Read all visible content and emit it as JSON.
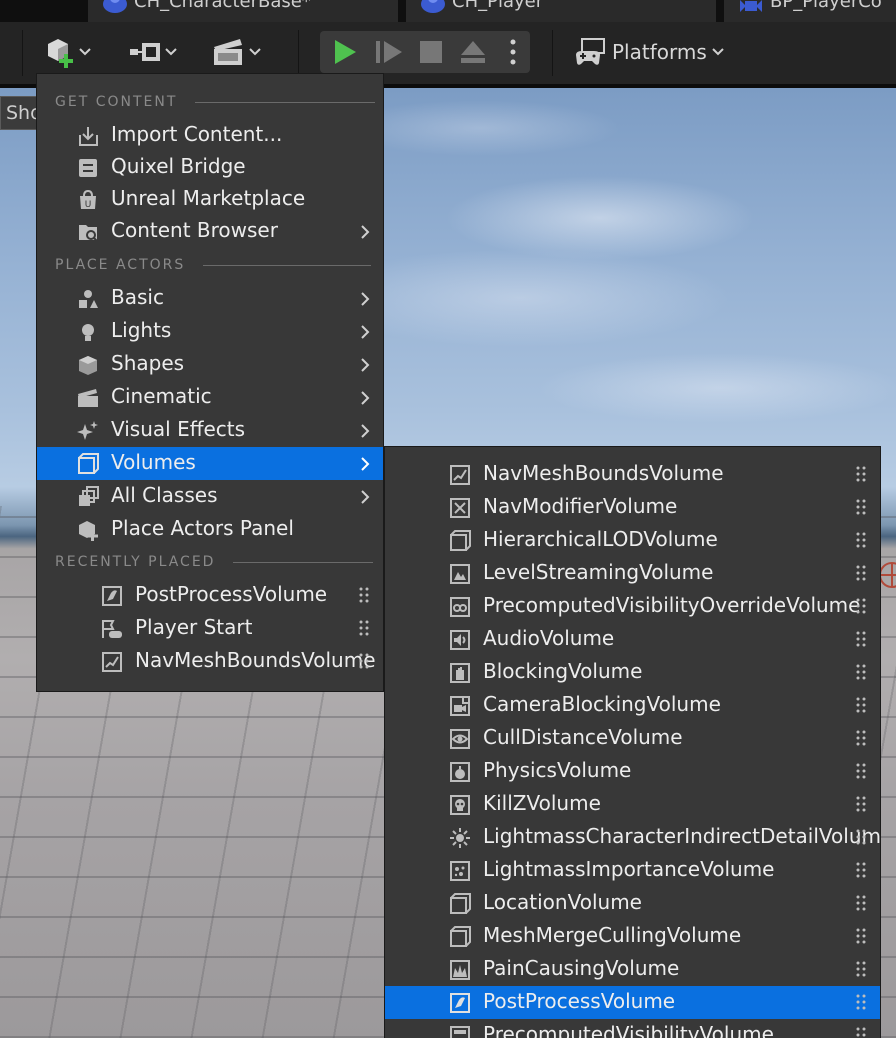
{
  "document_tabs": [
    "CH_CharacterBase*",
    "CH_Player",
    "BP_PlayerCo"
  ],
  "toolbar": {
    "platforms_label": "Platforms"
  },
  "viewport": {
    "show_label": "Sho"
  },
  "menu": {
    "sections": {
      "get_content": "GET CONTENT",
      "place_actors": "PLACE ACTORS",
      "recently_placed": "RECENTLY PLACED"
    },
    "get_content_items": [
      {
        "label": "Import Content...",
        "icon": "import-icon",
        "has_submenu": false
      },
      {
        "label": "Quixel Bridge",
        "icon": "quixel-bridge-icon",
        "has_submenu": false
      },
      {
        "label": "Unreal Marketplace",
        "icon": "marketplace-icon",
        "has_submenu": false
      },
      {
        "label": "Content Browser",
        "icon": "content-browser-icon",
        "has_submenu": true
      }
    ],
    "place_actors_items": [
      {
        "label": "Basic",
        "icon": "basic-actors-icon",
        "has_submenu": true
      },
      {
        "label": "Lights",
        "icon": "lightbulb-icon",
        "has_submenu": true
      },
      {
        "label": "Shapes",
        "icon": "cube-icon",
        "has_submenu": true
      },
      {
        "label": "Cinematic",
        "icon": "clapperboard-icon",
        "has_submenu": true
      },
      {
        "label": "Visual Effects",
        "icon": "sparkles-icon",
        "has_submenu": true
      },
      {
        "label": "Volumes",
        "icon": "volume-icon",
        "has_submenu": true,
        "selected": true
      },
      {
        "label": "All Classes",
        "icon": "all-classes-icon",
        "has_submenu": true
      },
      {
        "label": "Place Actors Panel",
        "icon": "place-actors-icon",
        "has_submenu": false
      }
    ],
    "recently_placed_items": [
      {
        "label": "PostProcessVolume",
        "icon": "postprocess-volume-icon"
      },
      {
        "label": "Player Start",
        "icon": "player-start-icon"
      },
      {
        "label": "NavMeshBoundsVolume",
        "icon": "navmesh-volume-icon"
      }
    ]
  },
  "submenu": {
    "items": [
      {
        "label": "NavMeshBoundsVolume",
        "icon": "navmesh-volume-icon"
      },
      {
        "label": "NavModifierVolume",
        "icon": "navmodifier-volume-icon"
      },
      {
        "label": "HierarchicalLODVolume",
        "icon": "volume-icon"
      },
      {
        "label": "LevelStreamingVolume",
        "icon": "levelstreaming-volume-icon"
      },
      {
        "label": "PrecomputedVisibilityOverrideVolume",
        "icon": "visibility-override-volume-icon"
      },
      {
        "label": "AudioVolume",
        "icon": "audio-volume-icon"
      },
      {
        "label": "BlockingVolume",
        "icon": "blocking-volume-icon"
      },
      {
        "label": "CameraBlockingVolume",
        "icon": "camera-blocking-volume-icon"
      },
      {
        "label": "CullDistanceVolume",
        "icon": "cull-distance-volume-icon"
      },
      {
        "label": "PhysicsVolume",
        "icon": "physics-volume-icon"
      },
      {
        "label": "KillZVolume",
        "icon": "skull-icon"
      },
      {
        "label": "LightmassCharacterIndirectDetailVolume",
        "icon": "sun-icon"
      },
      {
        "label": "LightmassImportanceVolume",
        "icon": "lightmass-importance-icon"
      },
      {
        "label": "LocationVolume",
        "icon": "volume-icon"
      },
      {
        "label": "MeshMergeCullingVolume",
        "icon": "volume-icon"
      },
      {
        "label": "PainCausingVolume",
        "icon": "pain-volume-icon"
      },
      {
        "label": "PostProcessVolume",
        "icon": "postprocess-volume-icon",
        "selected": true
      },
      {
        "label": "PrecomputedVisibilityVolume",
        "icon": "precomputed-visibility-icon"
      }
    ]
  },
  "colors": {
    "selection": "#0a70e0",
    "menu_bg": "#383838",
    "play_green": "#4fc24f",
    "add_icon_green": "#48c048"
  }
}
